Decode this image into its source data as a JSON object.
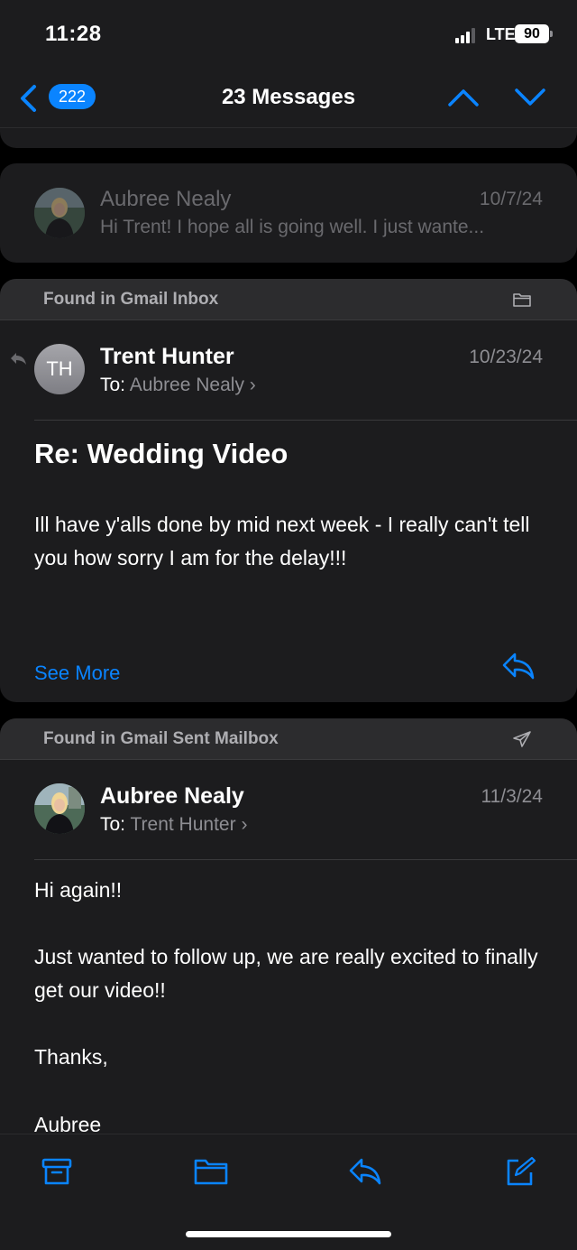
{
  "status": {
    "time": "11:28",
    "network": "LTE",
    "battery": "90"
  },
  "nav": {
    "badge_count": "222",
    "title": "23 Messages"
  },
  "collapsed_message": {
    "sender": "Aubree Nealy",
    "date": "10/7/24",
    "snippet": "Hi Trent! I hope all is going well. I just wante..."
  },
  "message1": {
    "found_in": "Found in Gmail Inbox",
    "initials": "TH",
    "sender": "Trent Hunter",
    "to_label": "To:",
    "to_name": "Aubree Nealy",
    "date": "10/23/24",
    "subject": "Re: Wedding Video",
    "body": "Ill have y'alls done by mid next week - I really can't tell you how sorry I am for the delay!!!",
    "see_more": "See More"
  },
  "message2": {
    "found_in": "Found in Gmail Sent Mailbox",
    "sender": "Aubree Nealy",
    "to_label": "To:",
    "to_name": "Trent Hunter",
    "date": "11/3/24",
    "body_lines": [
      "Hi again!!",
      "Just wanted to follow up, we are really excited to finally get our video!!",
      "Thanks,",
      "Aubree"
    ]
  },
  "toolbar": {
    "icons": [
      "archive-icon",
      "folder-icon",
      "reply-icon",
      "compose-icon"
    ]
  },
  "colors": {
    "accent": "#0a84ff",
    "background": "#000000",
    "card": "#1c1c1e",
    "header": "#2c2c2e",
    "secondary_text": "#8e8e93"
  }
}
